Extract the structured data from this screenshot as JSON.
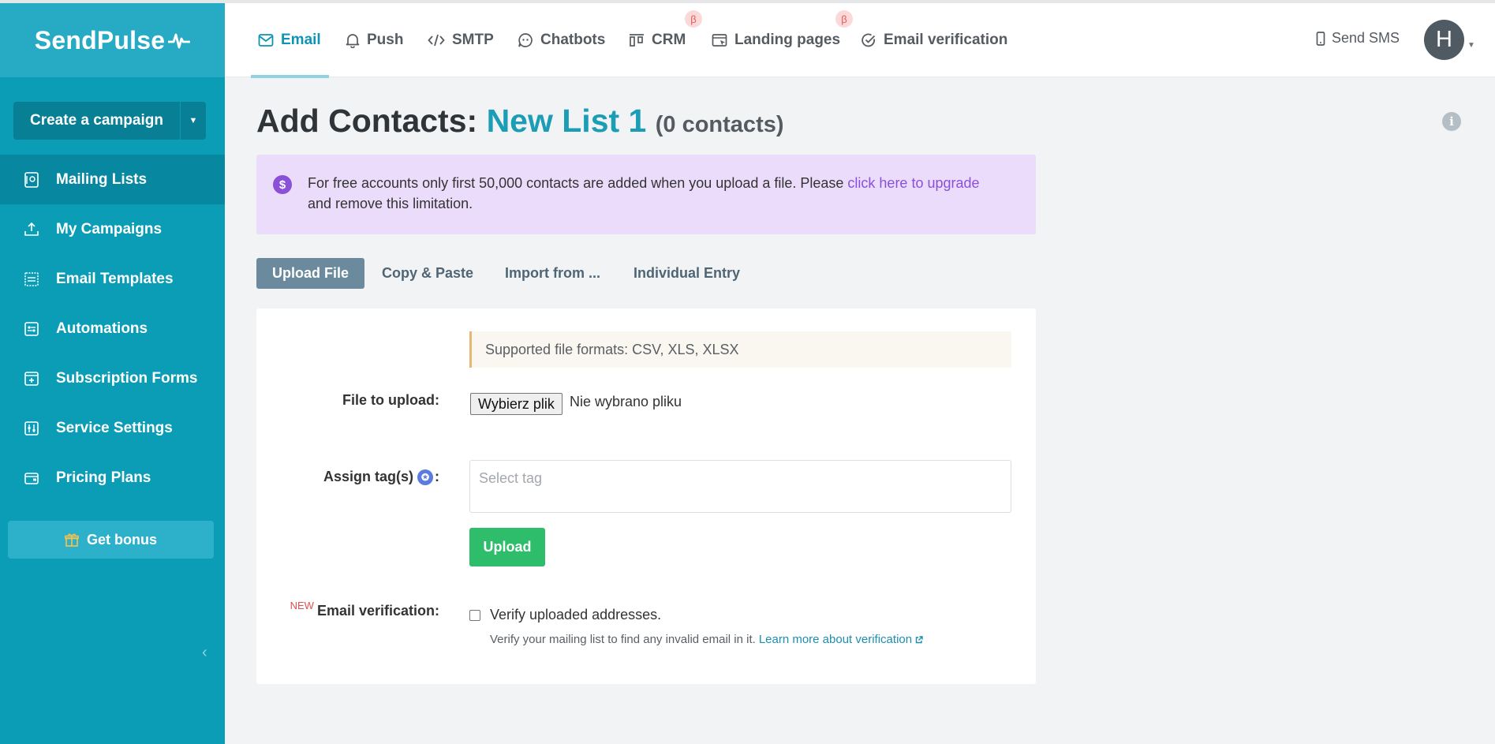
{
  "brand": {
    "logo_text": "SendPulse"
  },
  "sidebar": {
    "create_campaign": "Create a campaign",
    "items": [
      {
        "label": "Mailing Lists",
        "icon": "address-book-icon",
        "active": true
      },
      {
        "label": "My Campaigns",
        "icon": "upload-tray-icon",
        "active": false
      },
      {
        "label": "Email Templates",
        "icon": "template-icon",
        "active": false
      },
      {
        "label": "Automations",
        "icon": "automation-icon",
        "active": false
      },
      {
        "label": "Subscription Forms",
        "icon": "form-icon",
        "active": false
      },
      {
        "label": "Service Settings",
        "icon": "sliders-icon",
        "active": false
      },
      {
        "label": "Pricing Plans",
        "icon": "wallet-icon",
        "active": false
      }
    ],
    "get_bonus": "Get bonus"
  },
  "topnav": {
    "tabs": [
      {
        "label": "Email",
        "icon": "envelope-icon",
        "active": true
      },
      {
        "label": "Push",
        "icon": "bell-icon",
        "active": false
      },
      {
        "label": "SMTP",
        "icon": "code-icon",
        "active": false
      },
      {
        "label": "Chatbots",
        "icon": "chatbot-icon",
        "active": false
      },
      {
        "label": "CRM",
        "icon": "kanban-icon",
        "active": false,
        "beta": "β"
      },
      {
        "label": "Landing pages",
        "icon": "landing-icon",
        "active": false,
        "beta": "β"
      },
      {
        "label": "Email verification",
        "icon": "check-circle-icon",
        "active": false
      }
    ],
    "send_sms": "Send SMS",
    "avatar_initial": "H"
  },
  "page": {
    "title_prefix": "Add Contacts:",
    "list_name": "New List 1",
    "contact_count": "(0 contacts)"
  },
  "notice": {
    "text_before": "For free accounts only first 50,000 contacts are added when you upload a file. Please ",
    "link": "click here to upgrade",
    "text_after": "and remove this limitation.",
    "icon_symbol": "$"
  },
  "import_tabs": [
    {
      "label": "Upload File",
      "active": true
    },
    {
      "label": "Copy & Paste",
      "active": false
    },
    {
      "label": "Import from ...",
      "active": false
    },
    {
      "label": "Individual Entry",
      "active": false
    }
  ],
  "form": {
    "formats_note": "Supported file formats: CSV, XLS, XLSX",
    "file_label": "File to upload:",
    "file_button": "Wybierz plik",
    "file_none": "Nie wybrano pliku",
    "tag_label": "Assign tag(s)",
    "tag_colon": ":",
    "tag_placeholder": "Select tag",
    "upload_button": "Upload",
    "new_badge": "NEW",
    "verification_label": "Email verification:",
    "verify_checkbox_label": "Verify uploaded addresses.",
    "verify_checked": false,
    "verify_help": "Verify your mailing list to find any invalid email in it.",
    "verify_link": "Learn more about verification"
  },
  "colors": {
    "sidebar": "#0b9cb6",
    "accent": "#1b9db5",
    "notice_bg": "#ecdcfb",
    "upload_green": "#2ebd6b",
    "active_tab": "#6b8a9e"
  }
}
